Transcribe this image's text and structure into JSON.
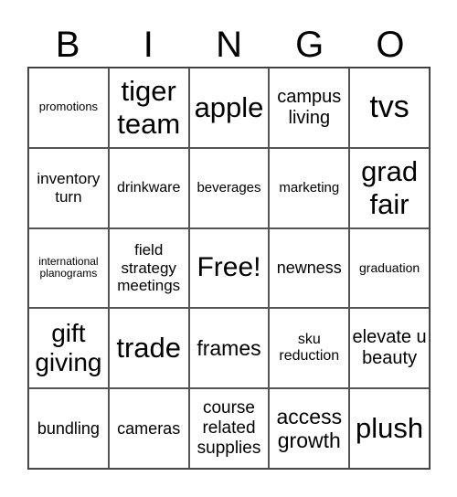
{
  "header": [
    "B",
    "I",
    "N",
    "G",
    "O"
  ],
  "cells": [
    "promotions",
    "tiger team",
    "apple",
    "campus living",
    "tvs",
    "inventory turn",
    "drinkware",
    "beverages",
    "marketing",
    "grad fair",
    "international planograms",
    "field strategy meetings",
    "Free!",
    "newness",
    "graduation",
    "gift giving",
    "trade",
    "frames",
    "sku reduction",
    "elevate u beauty",
    "bundling",
    "cameras",
    "course related supplies",
    "access growth",
    "plush"
  ]
}
